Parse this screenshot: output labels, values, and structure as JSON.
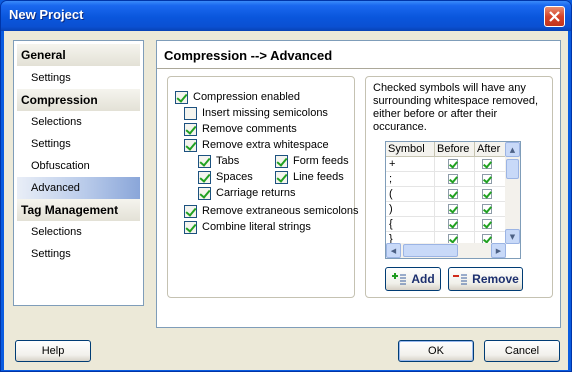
{
  "window": {
    "title": "New Project"
  },
  "nav": {
    "groups": [
      {
        "label": "General",
        "items": [
          {
            "label": "Settings"
          }
        ]
      },
      {
        "label": "Compression",
        "items": [
          {
            "label": "Selections"
          },
          {
            "label": "Settings"
          },
          {
            "label": "Obfuscation"
          },
          {
            "label": "Advanced",
            "active": true
          }
        ]
      },
      {
        "label": "Tag Management",
        "items": [
          {
            "label": "Selections"
          },
          {
            "label": "Settings"
          }
        ]
      }
    ]
  },
  "panel": {
    "title": "Compression --> Advanced",
    "options": [
      {
        "label": "Compression enabled",
        "checked": true
      },
      {
        "label": "Insert missing semicolons",
        "checked": false
      },
      {
        "label": "Remove comments",
        "checked": true
      },
      {
        "label": "Remove extra whitespace",
        "checked": true
      },
      {
        "label": "Tabs",
        "checked": true
      },
      {
        "label": "Form feeds",
        "checked": true
      },
      {
        "label": "Spaces",
        "checked": true
      },
      {
        "label": "Line feeds",
        "checked": true
      },
      {
        "label": "Carriage returns",
        "checked": true
      },
      {
        "label": "Remove extraneous semicolons",
        "checked": true
      },
      {
        "label": "Combine literal strings",
        "checked": true
      }
    ],
    "symbols": {
      "description": "Checked symbols will have any surrounding whitespace removed, either before or after their occurance.",
      "columns": [
        "Symbol",
        "Before",
        "After"
      ],
      "rows": [
        {
          "symbol": "+",
          "before": true,
          "after": true
        },
        {
          "symbol": ";",
          "before": true,
          "after": true
        },
        {
          "symbol": "(",
          "before": true,
          "after": true
        },
        {
          "symbol": ")",
          "before": true,
          "after": true
        },
        {
          "symbol": "{",
          "before": true,
          "after": true
        },
        {
          "symbol": "}",
          "before": true,
          "after": true
        }
      ],
      "add_label": "Add",
      "remove_label": "Remove"
    }
  },
  "buttons": {
    "help": "Help",
    "ok": "OK",
    "cancel": "Cancel"
  },
  "colors": {
    "titlebar": "#0a56dc",
    "client": "#ece9d8",
    "active_nav": "#8aa6d9",
    "check": "#21a121"
  }
}
